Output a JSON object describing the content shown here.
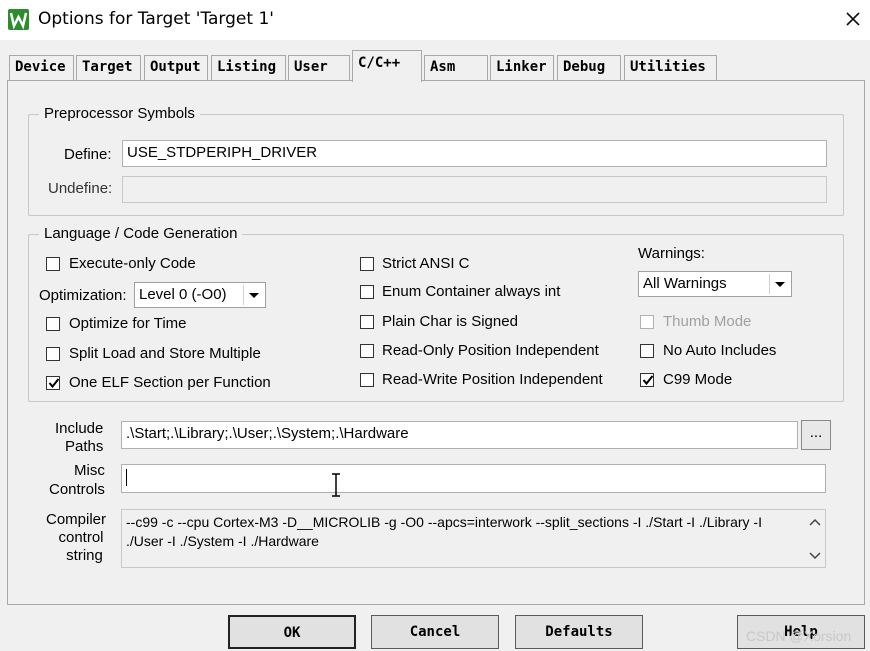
{
  "window": {
    "title": "Options for Target 'Target 1'",
    "close_label": "✕"
  },
  "tabs": [
    {
      "label": "Device"
    },
    {
      "label": "Target"
    },
    {
      "label": "Output"
    },
    {
      "label": "Listing"
    },
    {
      "label": "User"
    },
    {
      "label": "C/C++",
      "active": true
    },
    {
      "label": "Asm"
    },
    {
      "label": "Linker"
    },
    {
      "label": "Debug"
    },
    {
      "label": "Utilities"
    }
  ],
  "preprocessor": {
    "title": "Preprocessor Symbols",
    "define_label": "Define:",
    "define_value": "USE_STDPERIPH_DRIVER",
    "undefine_label": "Undefine:",
    "undefine_value": ""
  },
  "language": {
    "title": "Language / Code Generation",
    "execute_only": {
      "label": "Execute-only Code",
      "checked": false
    },
    "optimization_label": "Optimization:",
    "optimization_value": "Level 0 (-O0)",
    "optimize_time": {
      "label": "Optimize for Time",
      "checked": false
    },
    "split_load": {
      "label": "Split Load and Store Multiple",
      "checked": false
    },
    "one_elf": {
      "label": "One ELF Section per Function",
      "checked": true
    },
    "strict_ansi": {
      "label": "Strict ANSI C",
      "checked": false
    },
    "enum_container": {
      "label": "Enum Container always int",
      "checked": false
    },
    "plain_char": {
      "label": "Plain Char is Signed",
      "checked": false
    },
    "ro_pi": {
      "label": "Read-Only Position Independent",
      "checked": false
    },
    "rw_pi": {
      "label": "Read-Write Position Independent",
      "checked": false
    },
    "warnings_label": "Warnings:",
    "warnings_value": "All Warnings",
    "thumb_mode": {
      "label": "Thumb Mode",
      "checked": false,
      "disabled": true
    },
    "no_auto_includes": {
      "label": "No Auto Includes",
      "checked": false
    },
    "c99_mode": {
      "label": "C99 Mode",
      "checked": true
    }
  },
  "include": {
    "label_line1": "Include",
    "label_line2": "Paths",
    "value": ".\\Start;.\\Library;.\\User;.\\System;.\\Hardware",
    "browse_label": "..."
  },
  "misc": {
    "label_line1": "Misc",
    "label_line2": "Controls",
    "value": ""
  },
  "compiler": {
    "label_line1": "Compiler",
    "label_line2": "control",
    "label_line3": "string",
    "line1": "--c99 -c --cpu Cortex-M3 -D__MICROLIB -g -O0 --apcs=interwork --split_sections -I ./Start -I ./Library -I",
    "line2": "./User -I ./System -I ./Hardware"
  },
  "buttons": {
    "ok": "OK",
    "cancel": "Cancel",
    "defaults": "Defaults",
    "help": "Help"
  },
  "watermark": "CSDN @Xorsion"
}
